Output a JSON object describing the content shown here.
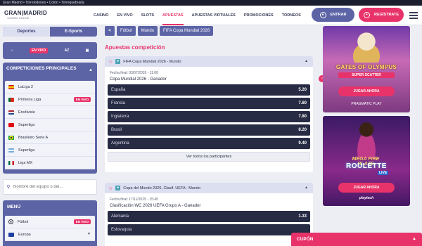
{
  "topbar": {
    "breadcrumb": "Gran Madrid • Torrelodones • Colón • Torrequebrada"
  },
  "logo": {
    "line1": "GRAN|MADRID",
    "line2": "CASINO ONLINE"
  },
  "nav": [
    "CASINO",
    "EN VIVO",
    "SLOTS",
    "APUESTAS",
    "APUESTAS VIRTUALES",
    "PROMOCIONES",
    "TORNEOS"
  ],
  "nav_active_index": 3,
  "header": {
    "login_label": "ENTRAR",
    "register_label": "REGÍSTRATE"
  },
  "sidebar": {
    "tabs": [
      "Deportes",
      "E-Sports"
    ],
    "filters": {
      "live": "EN VIVO",
      "az": "AZ"
    },
    "competitions": {
      "title": "COMPETICIONES PRINCIPALES",
      "items": [
        {
          "label": "LaLiga 2",
          "flag": "es",
          "live": ""
        },
        {
          "label": "Primeira Liga",
          "flag": "pt",
          "live": "EN VIVO"
        },
        {
          "label": "Eredivisie",
          "flag": "nl",
          "live": ""
        },
        {
          "label": "Superliga",
          "flag": "tr",
          "live": ""
        },
        {
          "label": "Brasileiro Serie A",
          "flag": "br",
          "live": ""
        },
        {
          "label": "Superliga",
          "flag": "ar",
          "live": ""
        },
        {
          "label": "Liga MX",
          "flag": "mx",
          "live": ""
        }
      ]
    },
    "search_placeholder": "Nombre del equipo o del...",
    "menu": {
      "title": "MENÚ",
      "items": [
        {
          "label": "Fútbol",
          "live": "EN VIVO"
        },
        {
          "label": "Europa",
          "live": ""
        }
      ]
    }
  },
  "breadcrumbs": [
    "Fútbol",
    "Mundo",
    "FIFA Copa Mundial 2026"
  ],
  "section_title": "Apuestas competición",
  "cards": [
    {
      "competition": "FIFA Copa Mundial 2026 - Mundo",
      "date": "Fecha final: 03/07/2026 - 11:00",
      "market": "Copa Mundial 2026 - Ganador",
      "odds": [
        {
          "team": "España",
          "odd": "5.20"
        },
        {
          "team": "Francia",
          "odd": "7.60"
        },
        {
          "team": "Inglaterra",
          "odd": "7.80"
        },
        {
          "team": "Brasil",
          "odd": "8.20"
        },
        {
          "team": "Argentina",
          "odd": "9.40"
        }
      ],
      "see_all": "Ver todos los participantes"
    },
    {
      "competition": "Copa del Mundo 2026, Clasif. UEFA - Mundo",
      "date": "Fecha final: 17/11/2025 - 15:45",
      "market": "Clasificación WC 2026 UEFA Grupo A - Ganador",
      "odds": [
        {
          "team": "Alemania",
          "odd": "1.33"
        },
        {
          "team": "Eslovaquia",
          "odd": ""
        }
      ]
    }
  ],
  "banners": [
    {
      "title": "GATES OF OLYMPUS",
      "subtitle": "SUPER SCATTER",
      "button": "JUGAR AHORA",
      "provider": "PRAGMATIC PLAY"
    },
    {
      "mega": "MEGA FIRE BLAZE",
      "title": "ROULETTE",
      "live": "LIVE",
      "button": "JUGAR AHORA",
      "provider": "playtech"
    }
  ],
  "cupon": {
    "label": "CUPÓN"
  },
  "colors": {
    "accent": "#e8336a",
    "primary": "#5c64a6",
    "dark_row": "#272b44"
  }
}
